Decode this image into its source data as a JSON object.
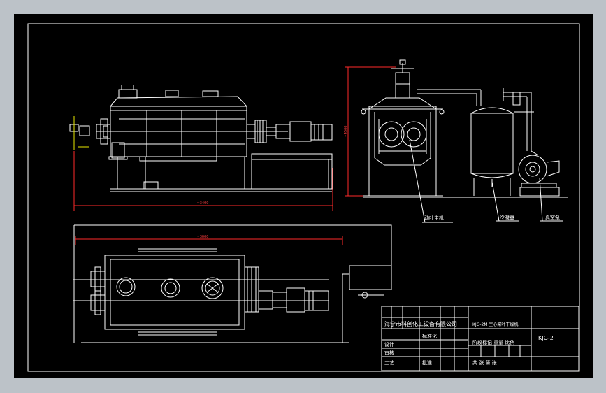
{
  "drawing": {
    "label_main_machine": "动叶主机",
    "label_condenser": "冷凝器",
    "label_vacuum_pump": "真空泵",
    "dim_length_side": "~3400",
    "dim_length_plan": "~3000",
    "dim_height": "~4500"
  },
  "title_block": {
    "company": "海宁市科创化工设备有限公司",
    "device_name": "KJG-2M 空心桨叶干燥机",
    "drawing_no": "KJG-2",
    "row_design": "设计",
    "row_check": "审核",
    "row_process": "工艺",
    "row_standard": "标准化",
    "row_approve": "批准",
    "mark_cols": "阶段标记 重量 比例",
    "sheets": "共 张 第 张"
  },
  "colors": {
    "background": "#000000",
    "frame": "#bcc2c8",
    "lines": "#ffffff",
    "dimensions": "#ff2a2a"
  }
}
